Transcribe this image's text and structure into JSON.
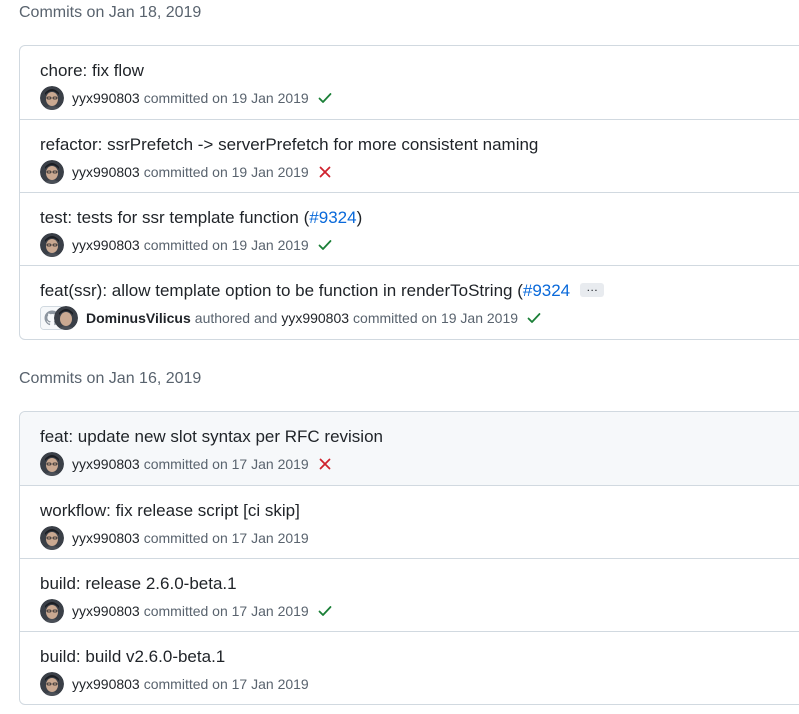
{
  "groups": [
    {
      "header": "Commits on Jan 18, 2019",
      "commits": [
        {
          "title": "chore: fix flow",
          "author": "yyx990803",
          "action": "committed on 19 Jan 2019",
          "status": "success"
        },
        {
          "title": "refactor: ssrPrefetch -> serverPrefetch for more consistent naming",
          "author": "yyx990803",
          "action": "committed on 19 Jan 2019",
          "status": "failure"
        },
        {
          "title_prefix": "test: tests for ssr template function (",
          "pr": "#9324",
          "title_suffix": ")",
          "author": "yyx990803",
          "action": "committed on 19 Jan 2019",
          "status": "success"
        },
        {
          "title_prefix": "feat(ssr): allow template option to be function in renderToString (",
          "pr": "#9324",
          "ellipsis": "…",
          "co_author": "DominusVilicus",
          "authored_text": "authored and",
          "author": "yyx990803",
          "action": "committed on 19 Jan 2019",
          "status": "success"
        }
      ]
    },
    {
      "header": "Commits on Jan 16, 2019",
      "commits": [
        {
          "title": "feat: update new slot syntax per RFC revision",
          "author": "yyx990803",
          "action": "committed on 17 Jan 2019",
          "status": "failure"
        },
        {
          "title": "workflow: fix release script [ci skip]",
          "author": "yyx990803",
          "action": "committed on 17 Jan 2019",
          "status": "none"
        },
        {
          "title": "build: release 2.6.0-beta.1",
          "author": "yyx990803",
          "action": "committed on 17 Jan 2019",
          "status": "success"
        },
        {
          "title": "build: build v2.6.0-beta.1",
          "author": "yyx990803",
          "action": "committed on 17 Jan 2019",
          "status": "none"
        }
      ]
    }
  ],
  "colors": {
    "success": "#1a7f37",
    "failure": "#cf222e",
    "link": "#0969da",
    "muted": "#59636e"
  },
  "icons": {
    "success": "check-icon",
    "failure": "x-icon"
  }
}
